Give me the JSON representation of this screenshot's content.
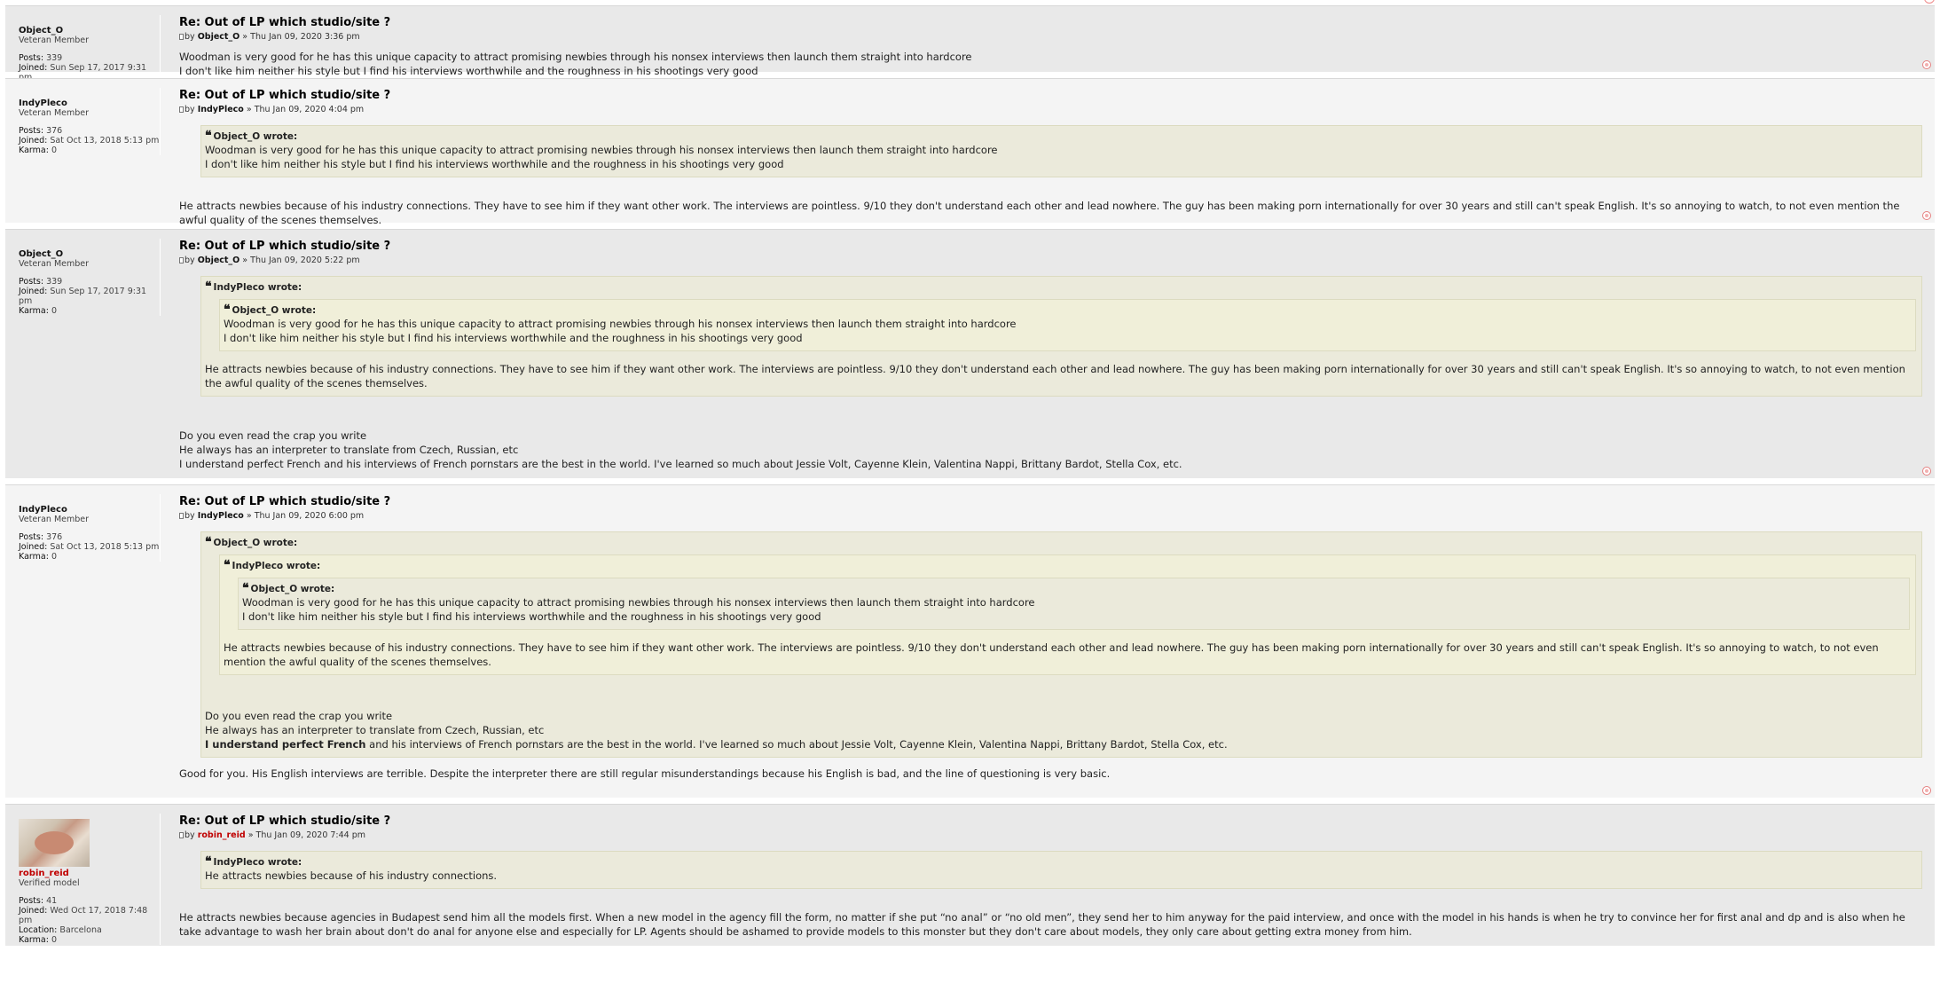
{
  "post_title": "Re: Out of LP which studio/site ?",
  "labels": {
    "posts": "Posts:",
    "joined": "Joined:",
    "karma": "Karma:",
    "location": "Location:",
    "by": "by",
    "sep": "»",
    "wrote": "wrote:"
  },
  "users": {
    "object_o": {
      "name": "Object_O",
      "rank": "Veteran Member",
      "posts": "339",
      "joined": "Sun Sep 17, 2017 9:31 pm",
      "karma": "0"
    },
    "indypleco": {
      "name": "IndyPleco",
      "rank": "Veteran Member",
      "posts": "376",
      "joined": "Sat Oct 13, 2018 5:13 pm",
      "karma": "0"
    },
    "robin_reid": {
      "name": "robin_reid",
      "rank": "Verified model",
      "posts": "41",
      "joined": "Wed Oct 17, 2018 7:48 pm",
      "location": "Barcelona",
      "karma": "0"
    }
  },
  "posts": [
    {
      "date": "Thu Jan 09, 2020 3:36 pm",
      "lines": [
        "Woodman is very good for he has this unique capacity to attract promising newbies through his nonsex interviews then launch them straight into hardcore",
        "I don't like him neither his style but I find his interviews worthwhile and the roughness in his shootings very good"
      ]
    },
    {
      "date": "Thu Jan 09, 2020 4:04 pm",
      "text": "He attracts newbies because of his industry connections. They have to see him if they want other work. The interviews are pointless. 9/10 they don't understand each other and lead nowhere. The guy has been making porn internationally for over 30 years and still can't speak English. It's so annoying to watch, to not even mention the awful quality of the scenes themselves."
    },
    {
      "date": "Thu Jan 09, 2020 5:22 pm",
      "lines": [
        "Do you even read the crap you write",
        "He always has an interpreter to translate from Czech, Russian, etc",
        "I understand perfect French and his interviews of French pornstars are the best in the world. I've learned so much about Jessie Volt, Cayenne Klein, Valentina Nappi, Brittany Bardot, Stella Cox, etc."
      ]
    },
    {
      "date": "Thu Jan 09, 2020 6:00 pm",
      "bold_prefix": "I understand perfect French",
      "bold_rest": " and his interviews of French pornstars are the best in the world. I've learned so much about Jessie Volt, Cayenne Klein, Valentina Nappi, Brittany Bardot, Stella Cox, etc.",
      "text": "Good for you. His English interviews are terrible. Despite the interpreter there are still regular misunderstandings because his English is bad, and the line of questioning is very basic."
    },
    {
      "date": "Thu Jan 09, 2020 7:44 pm",
      "quote": "He attracts newbies because of his industry connections.",
      "text": "He attracts newbies because agencies in Budapest send him all the models first. When a new model in the agency fill the form, no matter if she put “no anal” or “no old men”, they send her to him anyway for the paid interview, and once with the model in his hands is when he try to convince her for first anal and dp and is also when he take advantage to wash her brain about don't do anal for anyone else and especially for LP. Agents should be ashamed to provide models to this monster but they don't care about models, they only care about getting extra money from him."
    }
  ],
  "colors": {
    "username_special": "#c00000",
    "quote_bg": "#ebeadb",
    "row_dark": "#e9e9e9",
    "row_light": "#f4f4f4"
  },
  "icons": {
    "quote": "quote-icon",
    "post": "post-icon",
    "top": "back-to-top-icon"
  }
}
